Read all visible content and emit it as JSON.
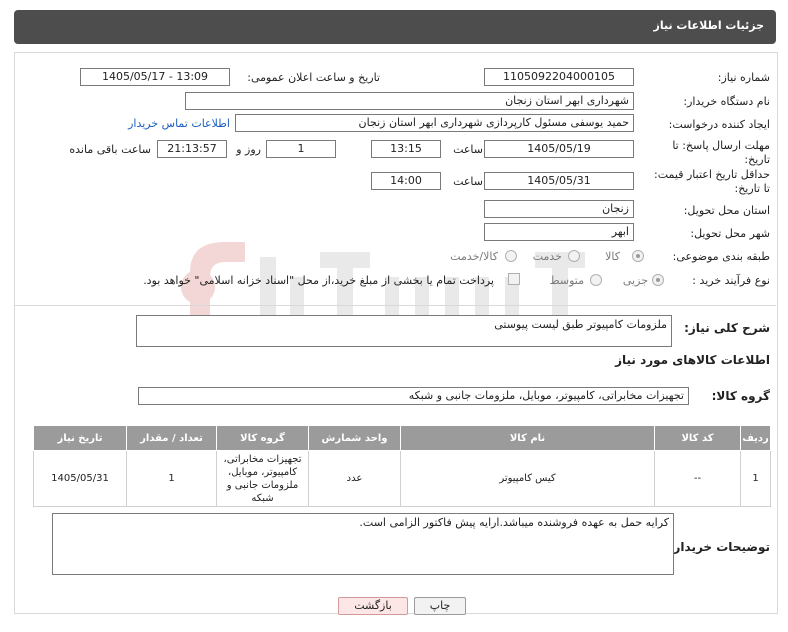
{
  "header": {
    "title": "جزئیات اطلاعات نیاز"
  },
  "form": {
    "need_number": {
      "label": "شماره نیاز:",
      "value": "1105092204000105"
    },
    "announce": {
      "label": "تاریخ و ساعت اعلان عمومی:",
      "value": "1405/05/17 - 13:09"
    },
    "buyer_org": {
      "label": "نام دستگاه خریدار:",
      "value": "شهرداری ابهر استان زنجان"
    },
    "requester": {
      "label": "ایجاد کننده درخواست:",
      "value": "حمید یوسفی مسئول کارپردازی شهرداری ابهر استان زنجان",
      "contact_link": "اطلاعات تماس خریدار"
    },
    "deadline": {
      "label_1": "مهلت ارسال پاسخ: تا",
      "label_2": "تاریخ:",
      "date": "1405/05/19",
      "time_label": "ساعت",
      "time": "13:15",
      "days": "1",
      "days_label": "روز و",
      "remaining": "21:13:57",
      "remaining_label": "ساعت باقی مانده"
    },
    "price_validity": {
      "label_1": "حداقل تاریخ اعتبار قیمت:",
      "label_2": "تا تاریخ:",
      "date": "1405/05/31",
      "time_label": "ساعت",
      "time": "14:00"
    },
    "delivery_province": {
      "label": "استان محل تحویل:",
      "value": "زنجان"
    },
    "delivery_city": {
      "label": "شهر محل تحویل:",
      "value": "ابهر"
    },
    "category": {
      "label": "طبقه بندی موضوعی:",
      "options": [
        "کالا",
        "خدمت",
        "کالا/خدمت"
      ]
    },
    "process": {
      "label": "نوع فرآیند خرید :",
      "options": [
        "جزیی",
        "متوسط"
      ],
      "payment_note": "پرداخت تمام یا بخشی از مبلغ خرید،از محل \"اسناد خزانه اسلامی\" خواهد بود."
    }
  },
  "summary": {
    "label": "شرح کلی نیاز:",
    "value": "ملزومات کامپیوتر طبق لیست پیوستی"
  },
  "goods_info": {
    "title": "اطلاعات کالاهای مورد نیاز",
    "group_label": "گروه کالا:",
    "group_value": "تجهیزات مخابراتی، کامپیوتر، موبایل، ملزومات جانبی و شبکه",
    "columns": [
      "ردیف",
      "کد کالا",
      "نام کالا",
      "واحد شمارش",
      "گروه کالا",
      "تعداد / مقدار",
      "تاریخ نیاز"
    ],
    "rows": [
      {
        "row": "1",
        "code": "--",
        "name": "کیس کامپیوتر",
        "unit": "عدد",
        "group": "تجهیزات مخابراتی، کامپیوتر، موبایل، ملزومات جانبی و شبکه",
        "qty": "1",
        "date": "1405/05/31"
      }
    ]
  },
  "buyer_notes": {
    "label": "توضیحات خریدار:",
    "value": "کرایه حمل به عهده فروشنده میباشد.ارایه پیش فاکتور الزامی است."
  },
  "actions": {
    "print": "چاپ",
    "back": "بازگشت"
  },
  "colors": {
    "header_bg": "#4d4d4d",
    "table_header": "#9b9b9b",
    "link": "#1a5fc1",
    "back_button": "#fde6e6"
  }
}
